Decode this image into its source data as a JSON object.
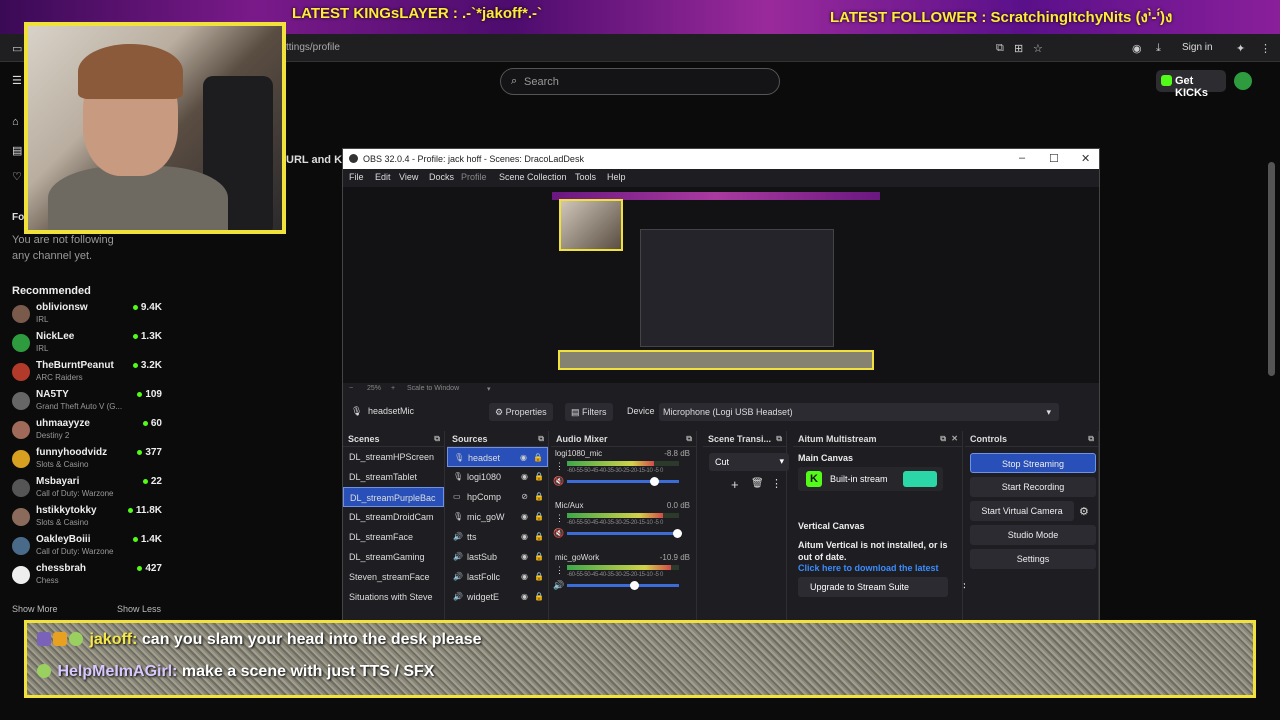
{
  "banner": {
    "kingslayer": "LATEST KINGsLAYER : .-`*jakoff*.-`",
    "follower": "LATEST FOLLOWER : ScratchingItchyNits (ง'̀-'́)ง"
  },
  "browser": {
    "url_fragment": "ttings/profile",
    "sign_in": "Sign in"
  },
  "kick": {
    "search_placeholder": "Search",
    "get_kicks": "Get KICKs",
    "following_heading": "Fo",
    "following_empty": "You are not following any channel yet.",
    "url_key_fragment": "URL and Ke",
    "recommended_title": "Recommended",
    "recommended": [
      {
        "name": "oblivionsw",
        "category": "IRL",
        "viewers": "9.4K",
        "color": "#7a5a4a"
      },
      {
        "name": "NickLee",
        "category": "IRL",
        "viewers": "1.3K",
        "color": "#2e9b3e"
      },
      {
        "name": "TheBurntPeanut",
        "category": "ARC Raiders",
        "viewers": "3.2K",
        "color": "#b23a2a"
      },
      {
        "name": "NA5TY",
        "category": "Grand Theft Auto V (G...",
        "viewers": "109",
        "color": "#666666"
      },
      {
        "name": "uhmaayyze",
        "category": "Destiny 2",
        "viewers": "60",
        "color": "#a06a5a"
      },
      {
        "name": "funnyhoodvidz",
        "category": "Slots & Casino",
        "viewers": "377",
        "color": "#d8a020"
      },
      {
        "name": "Msbayari",
        "category": "Call of Duty: Warzone",
        "viewers": "22",
        "color": "#555555"
      },
      {
        "name": "hstikkytokky",
        "category": "Slots & Casino",
        "viewers": "11.8K",
        "color": "#8a6a5a"
      },
      {
        "name": "OakleyBoiii",
        "category": "Call of Duty: Warzone",
        "viewers": "1.4K",
        "color": "#4a6a8a"
      },
      {
        "name": "chessbrah",
        "category": "Chess",
        "viewers": "427",
        "color": "#eeeeee"
      }
    ],
    "show_more": "Show More",
    "show_less": "Show Less"
  },
  "obs": {
    "title": "OBS 32.0.4 - Profile: jack hoff - Scenes: DracoLadDesk",
    "menu": [
      "File",
      "Edit",
      "View",
      "Docks",
      "Profile",
      "Scene Collection",
      "Tools",
      "Help"
    ],
    "zoom": "25%",
    "scale_label": "Scale to Window",
    "selected_source": "headsetMic",
    "properties": "Properties",
    "filters": "Filters",
    "device_label": "Device",
    "device_value": "Microphone (Logi USB Headset)",
    "docks": {
      "scenes": "Scenes",
      "sources": "Sources",
      "mixer": "Audio Mixer",
      "transitions": "Scene Transi...",
      "multistream": "Aitum Multistream",
      "controls": "Controls"
    },
    "scenes": [
      "DL_streamHPScreen",
      "DL_streamTablet",
      "DL_streamPurpleBac",
      "DL_streamDroidCam",
      "DL_streamFace",
      "DL_streamGaming",
      "Steven_streamFace",
      "Situations with Steve"
    ],
    "sources": [
      "headset",
      "logi1080",
      "hpComp",
      "mic_goW",
      "tts",
      "lastSub",
      "lastFollc",
      "widgetE"
    ],
    "mixer": [
      {
        "name": "logi1080_mic",
        "db": "-8.8 dB",
        "level": 0.78,
        "fader": 0.78
      },
      {
        "name": "Mic/Aux",
        "db": "0.0 dB",
        "level": 0.86,
        "fader": 0.98
      },
      {
        "name": "mic_goWork",
        "db": "-10.9 dB",
        "level": 0.93,
        "fader": 0.6
      }
    ],
    "mixer_scale": "-60-55-50-45-40-35-30-25-20-15-10 -5 0",
    "transition": "Cut",
    "multistream_main": "Main Canvas",
    "multistream_builtin": "Built-in stream",
    "multistream_vertical": "Vertical Canvas",
    "multistream_warning": "Aitum Vertical is not installed, or is out of date.",
    "multistream_link": "Click here to download the latest",
    "multistream_upgrade": "Upgrade to Stream Suite",
    "controls": [
      "Stop Streaming",
      "Start Recording",
      "Start Virtual Camera",
      "Studio Mode",
      "Settings"
    ]
  },
  "chat": [
    {
      "user": "jakoff:",
      "message": "can you slam your head into the desk please"
    },
    {
      "user": "HelpMeImAGirl:",
      "message": "make a scene with just TTS / SFX"
    }
  ]
}
